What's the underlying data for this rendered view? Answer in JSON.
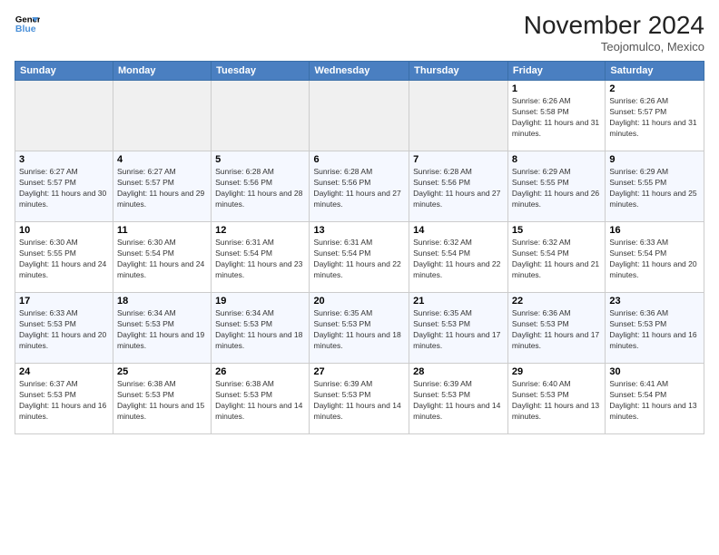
{
  "header": {
    "logo_line1": "General",
    "logo_line2": "Blue",
    "month": "November 2024",
    "location": "Teojomulco, Mexico"
  },
  "weekdays": [
    "Sunday",
    "Monday",
    "Tuesday",
    "Wednesday",
    "Thursday",
    "Friday",
    "Saturday"
  ],
  "weeks": [
    [
      {
        "day": null
      },
      {
        "day": null
      },
      {
        "day": null
      },
      {
        "day": null
      },
      {
        "day": null
      },
      {
        "day": 1,
        "sunrise": "6:26 AM",
        "sunset": "5:58 PM",
        "daylight": "11 hours and 31 minutes."
      },
      {
        "day": 2,
        "sunrise": "6:26 AM",
        "sunset": "5:57 PM",
        "daylight": "11 hours and 31 minutes."
      }
    ],
    [
      {
        "day": 3,
        "sunrise": "6:27 AM",
        "sunset": "5:57 PM",
        "daylight": "11 hours and 30 minutes."
      },
      {
        "day": 4,
        "sunrise": "6:27 AM",
        "sunset": "5:57 PM",
        "daylight": "11 hours and 29 minutes."
      },
      {
        "day": 5,
        "sunrise": "6:28 AM",
        "sunset": "5:56 PM",
        "daylight": "11 hours and 28 minutes."
      },
      {
        "day": 6,
        "sunrise": "6:28 AM",
        "sunset": "5:56 PM",
        "daylight": "11 hours and 27 minutes."
      },
      {
        "day": 7,
        "sunrise": "6:28 AM",
        "sunset": "5:56 PM",
        "daylight": "11 hours and 27 minutes."
      },
      {
        "day": 8,
        "sunrise": "6:29 AM",
        "sunset": "5:55 PM",
        "daylight": "11 hours and 26 minutes."
      },
      {
        "day": 9,
        "sunrise": "6:29 AM",
        "sunset": "5:55 PM",
        "daylight": "11 hours and 25 minutes."
      }
    ],
    [
      {
        "day": 10,
        "sunrise": "6:30 AM",
        "sunset": "5:55 PM",
        "daylight": "11 hours and 24 minutes."
      },
      {
        "day": 11,
        "sunrise": "6:30 AM",
        "sunset": "5:54 PM",
        "daylight": "11 hours and 24 minutes."
      },
      {
        "day": 12,
        "sunrise": "6:31 AM",
        "sunset": "5:54 PM",
        "daylight": "11 hours and 23 minutes."
      },
      {
        "day": 13,
        "sunrise": "6:31 AM",
        "sunset": "5:54 PM",
        "daylight": "11 hours and 22 minutes."
      },
      {
        "day": 14,
        "sunrise": "6:32 AM",
        "sunset": "5:54 PM",
        "daylight": "11 hours and 22 minutes."
      },
      {
        "day": 15,
        "sunrise": "6:32 AM",
        "sunset": "5:54 PM",
        "daylight": "11 hours and 21 minutes."
      },
      {
        "day": 16,
        "sunrise": "6:33 AM",
        "sunset": "5:54 PM",
        "daylight": "11 hours and 20 minutes."
      }
    ],
    [
      {
        "day": 17,
        "sunrise": "6:33 AM",
        "sunset": "5:53 PM",
        "daylight": "11 hours and 20 minutes."
      },
      {
        "day": 18,
        "sunrise": "6:34 AM",
        "sunset": "5:53 PM",
        "daylight": "11 hours and 19 minutes."
      },
      {
        "day": 19,
        "sunrise": "6:34 AM",
        "sunset": "5:53 PM",
        "daylight": "11 hours and 18 minutes."
      },
      {
        "day": 20,
        "sunrise": "6:35 AM",
        "sunset": "5:53 PM",
        "daylight": "11 hours and 18 minutes."
      },
      {
        "day": 21,
        "sunrise": "6:35 AM",
        "sunset": "5:53 PM",
        "daylight": "11 hours and 17 minutes."
      },
      {
        "day": 22,
        "sunrise": "6:36 AM",
        "sunset": "5:53 PM",
        "daylight": "11 hours and 17 minutes."
      },
      {
        "day": 23,
        "sunrise": "6:36 AM",
        "sunset": "5:53 PM",
        "daylight": "11 hours and 16 minutes."
      }
    ],
    [
      {
        "day": 24,
        "sunrise": "6:37 AM",
        "sunset": "5:53 PM",
        "daylight": "11 hours and 16 minutes."
      },
      {
        "day": 25,
        "sunrise": "6:38 AM",
        "sunset": "5:53 PM",
        "daylight": "11 hours and 15 minutes."
      },
      {
        "day": 26,
        "sunrise": "6:38 AM",
        "sunset": "5:53 PM",
        "daylight": "11 hours and 14 minutes."
      },
      {
        "day": 27,
        "sunrise": "6:39 AM",
        "sunset": "5:53 PM",
        "daylight": "11 hours and 14 minutes."
      },
      {
        "day": 28,
        "sunrise": "6:39 AM",
        "sunset": "5:53 PM",
        "daylight": "11 hours and 14 minutes."
      },
      {
        "day": 29,
        "sunrise": "6:40 AM",
        "sunset": "5:53 PM",
        "daylight": "11 hours and 13 minutes."
      },
      {
        "day": 30,
        "sunrise": "6:41 AM",
        "sunset": "5:54 PM",
        "daylight": "11 hours and 13 minutes."
      }
    ]
  ]
}
